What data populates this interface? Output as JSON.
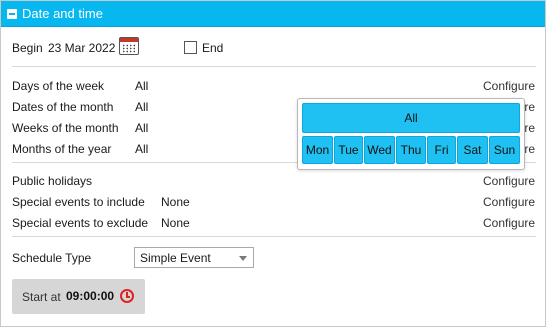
{
  "header": {
    "title": "Date and time",
    "icon": "collapse-icon"
  },
  "range": {
    "begin_label": "Begin",
    "begin_date": "23 Mar 2022",
    "end_label": "End",
    "end_checked": false
  },
  "recurrence": {
    "rows": [
      {
        "label": "Days of the week",
        "value": "All",
        "action": "Configure"
      },
      {
        "label": "Dates of the month",
        "value": "All",
        "action": "Configure"
      },
      {
        "label": "Weeks of the month",
        "value": "All",
        "action": "Configure"
      },
      {
        "label": "Months of the year",
        "value": "All",
        "action": "Configure"
      }
    ]
  },
  "popup": {
    "all_label": "All",
    "days": [
      "Mon",
      "Tue",
      "Wed",
      "Thu",
      "Fri",
      "Sat",
      "Sun"
    ]
  },
  "special": {
    "rows": [
      {
        "label": "Public holidays",
        "value": "",
        "action": "Configure"
      },
      {
        "label": "Special events to include",
        "value": "None",
        "action": "Configure"
      },
      {
        "label": "Special events to exclude",
        "value": "None",
        "action": "Configure"
      }
    ]
  },
  "schedule": {
    "label": "Schedule Type",
    "selected": "Simple Event"
  },
  "start": {
    "label": "Start at",
    "time": "09:00:00"
  },
  "colors": {
    "header": "#07b7ef",
    "day_button": "#1fc1f3",
    "clock": "#dd2222"
  }
}
